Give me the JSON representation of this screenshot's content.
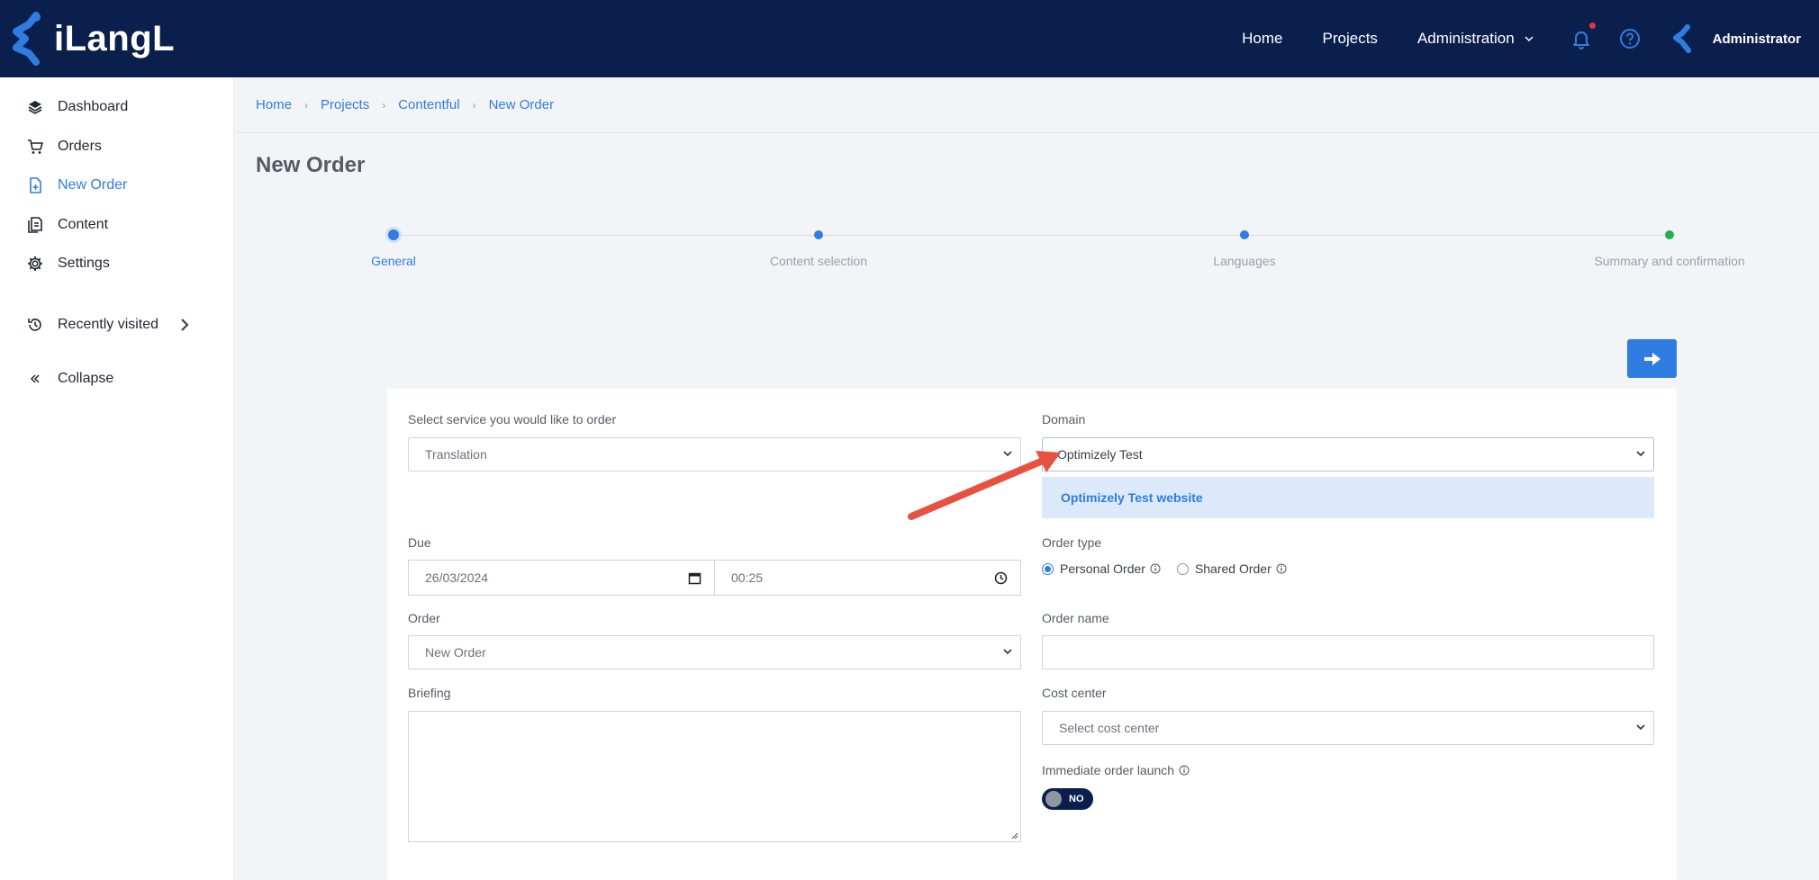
{
  "brand": {
    "name": "iLangL"
  },
  "topnav": {
    "home": "Home",
    "projects": "Projects",
    "administration": "Administration",
    "user": "Administrator"
  },
  "sidebar": {
    "items": [
      {
        "label": "Dashboard",
        "icon": "layers-icon"
      },
      {
        "label": "Orders",
        "icon": "cart-icon"
      },
      {
        "label": "New Order",
        "icon": "file-plus-icon"
      },
      {
        "label": "Content",
        "icon": "document-icon"
      },
      {
        "label": "Settings",
        "icon": "gear-icon"
      }
    ],
    "recently_visited": "Recently visited",
    "collapse": "Collapse"
  },
  "breadcrumb": [
    "Home",
    "Projects",
    "Contentful",
    "New Order"
  ],
  "page": {
    "title": "New Order"
  },
  "stepper": {
    "current_index": 0,
    "steps": [
      {
        "label": "General",
        "color": "#2f7de1"
      },
      {
        "label": "Content selection",
        "color": "#2f7de1"
      },
      {
        "label": "Languages",
        "color": "#2f7de1"
      },
      {
        "label": "Summary and confirmation",
        "color": "#22b14c"
      }
    ]
  },
  "form": {
    "service_label": "Select service you would like to order",
    "service_value": "Translation",
    "domain_label": "Domain",
    "domain_value": "Optimizely Test",
    "domain_info": "Optimizely Test website",
    "due_label": "Due",
    "due_date": "26/03/2024",
    "due_time": "00:25",
    "order_type_label": "Order type",
    "order_type_options": [
      "Personal Order",
      "Shared Order"
    ],
    "order_type_selected": "Personal Order",
    "order_label": "Order",
    "order_value": "New Order",
    "order_name_label": "Order name",
    "order_name_value": "",
    "briefing_label": "Briefing",
    "briefing_value": "",
    "cost_center_label": "Cost center",
    "cost_center_placeholder": "Select cost center",
    "immediate_launch_label": "Immediate order launch",
    "immediate_launch_state": "NO"
  },
  "colors": {
    "header_bg": "#0b1f4d",
    "accent": "#2f7de1",
    "info_bg": "#dbe9fb",
    "annotation_arrow": "#e8503f"
  }
}
